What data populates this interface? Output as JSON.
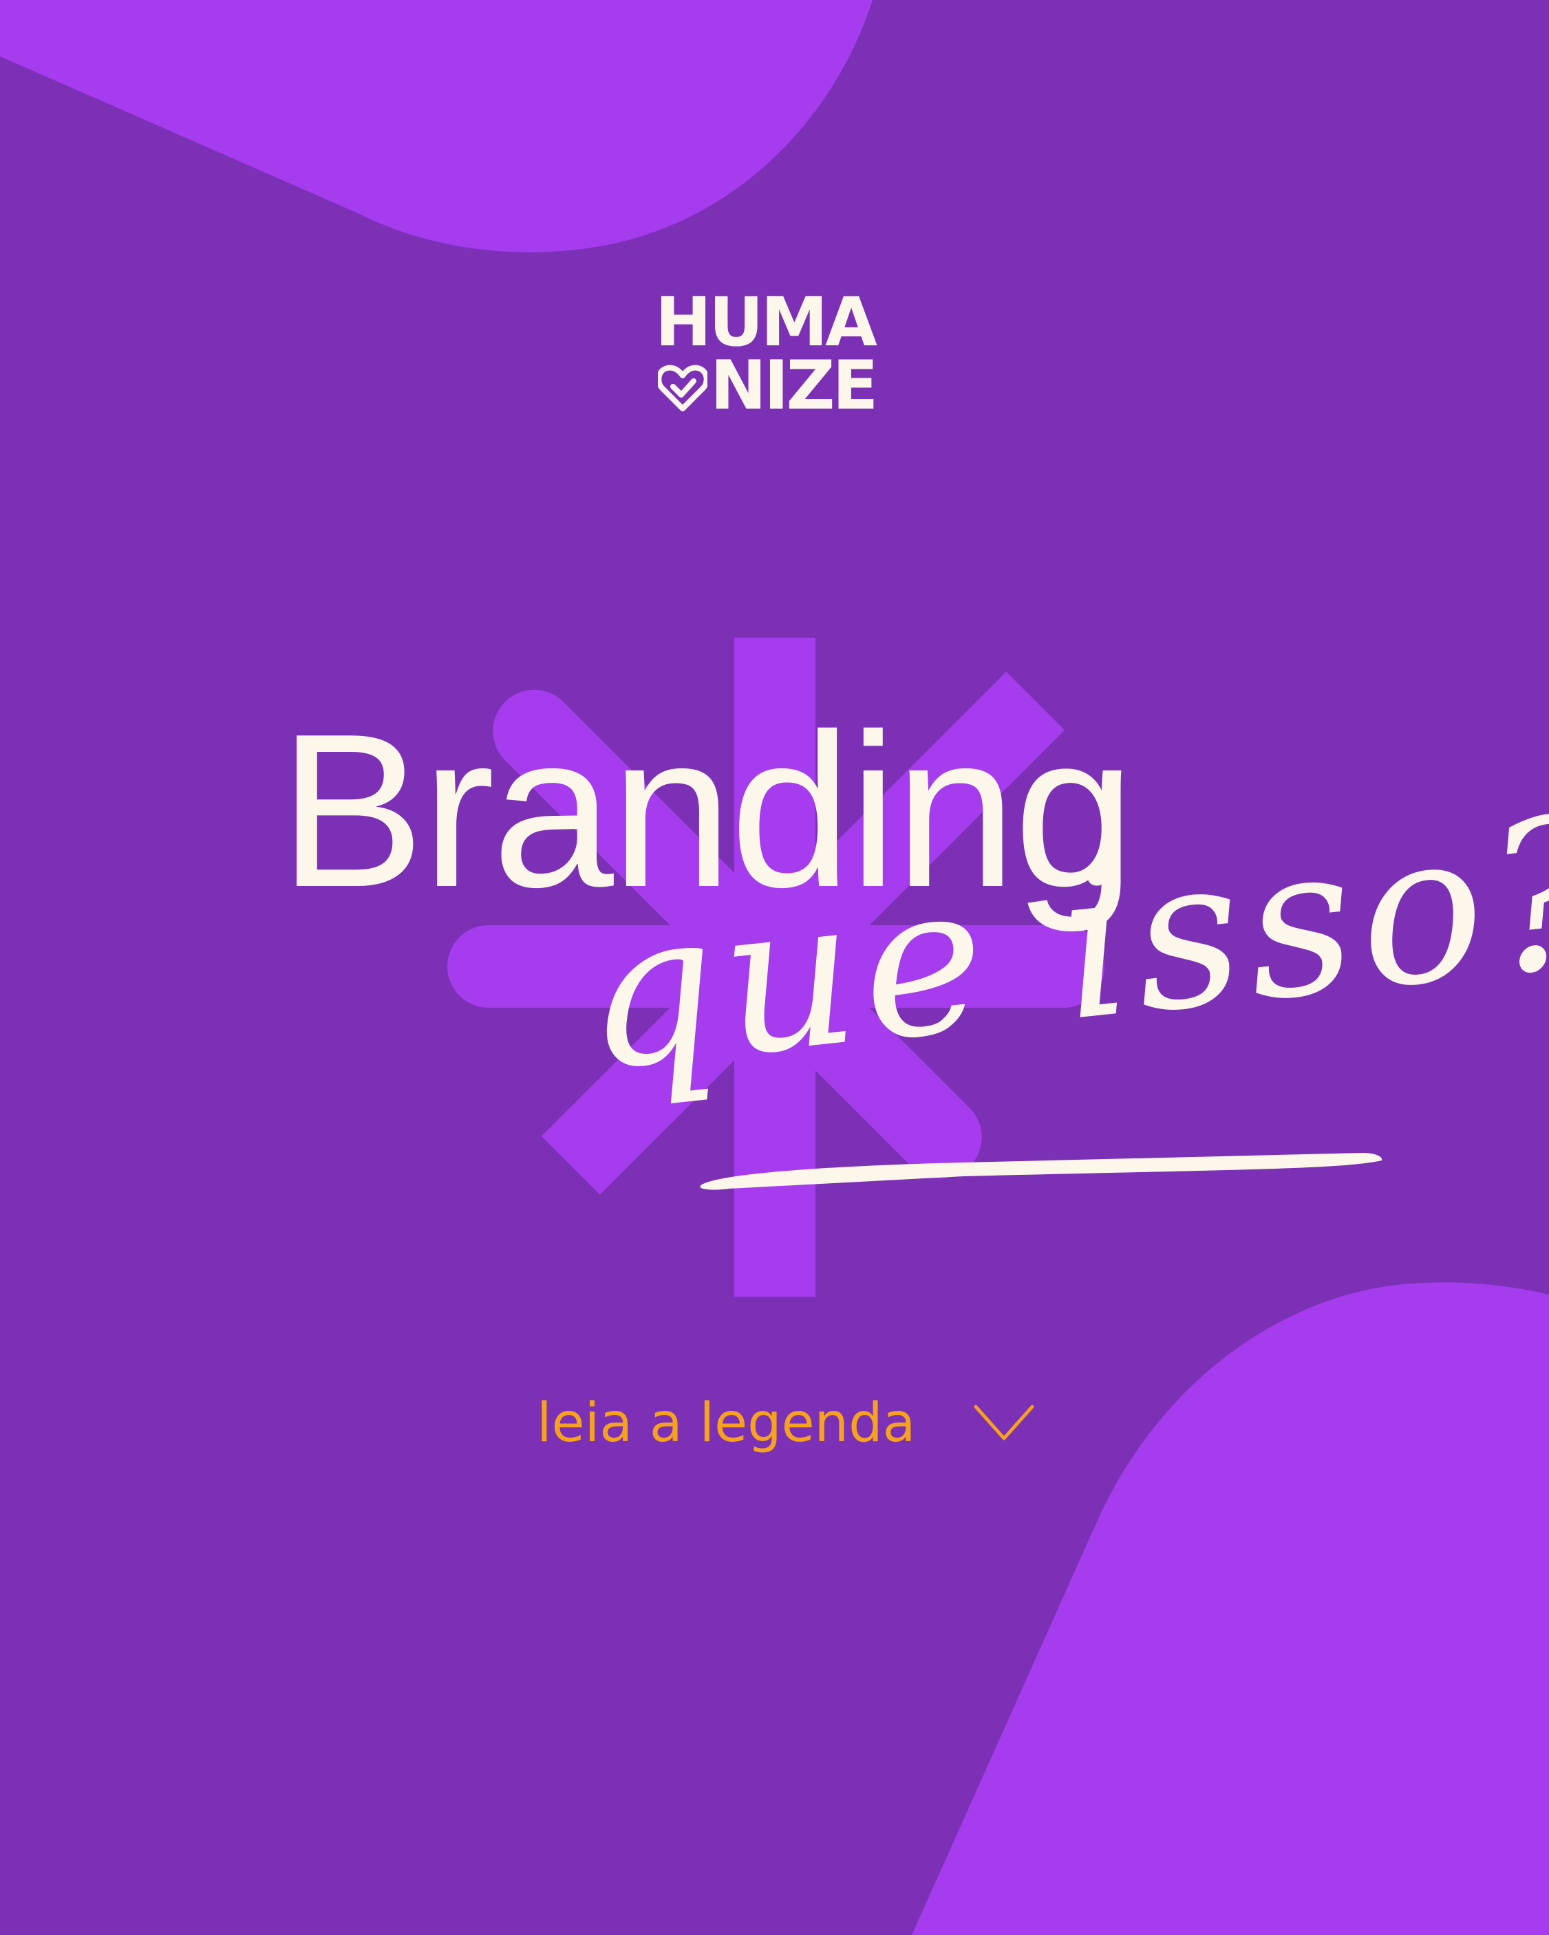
{
  "logo": {
    "line1": "HUMA",
    "line2": "NIZE",
    "icon": "heart-icon"
  },
  "headline": "Branding",
  "subheadline": "que isso?",
  "cta": {
    "label": "leia a legenda",
    "icon": "chevron-down-icon"
  },
  "colors": {
    "background": "#7b30b6",
    "accent_purple": "#a53cee",
    "text_cream": "#fdf6ea",
    "cta_orange": "#f6a21e"
  }
}
